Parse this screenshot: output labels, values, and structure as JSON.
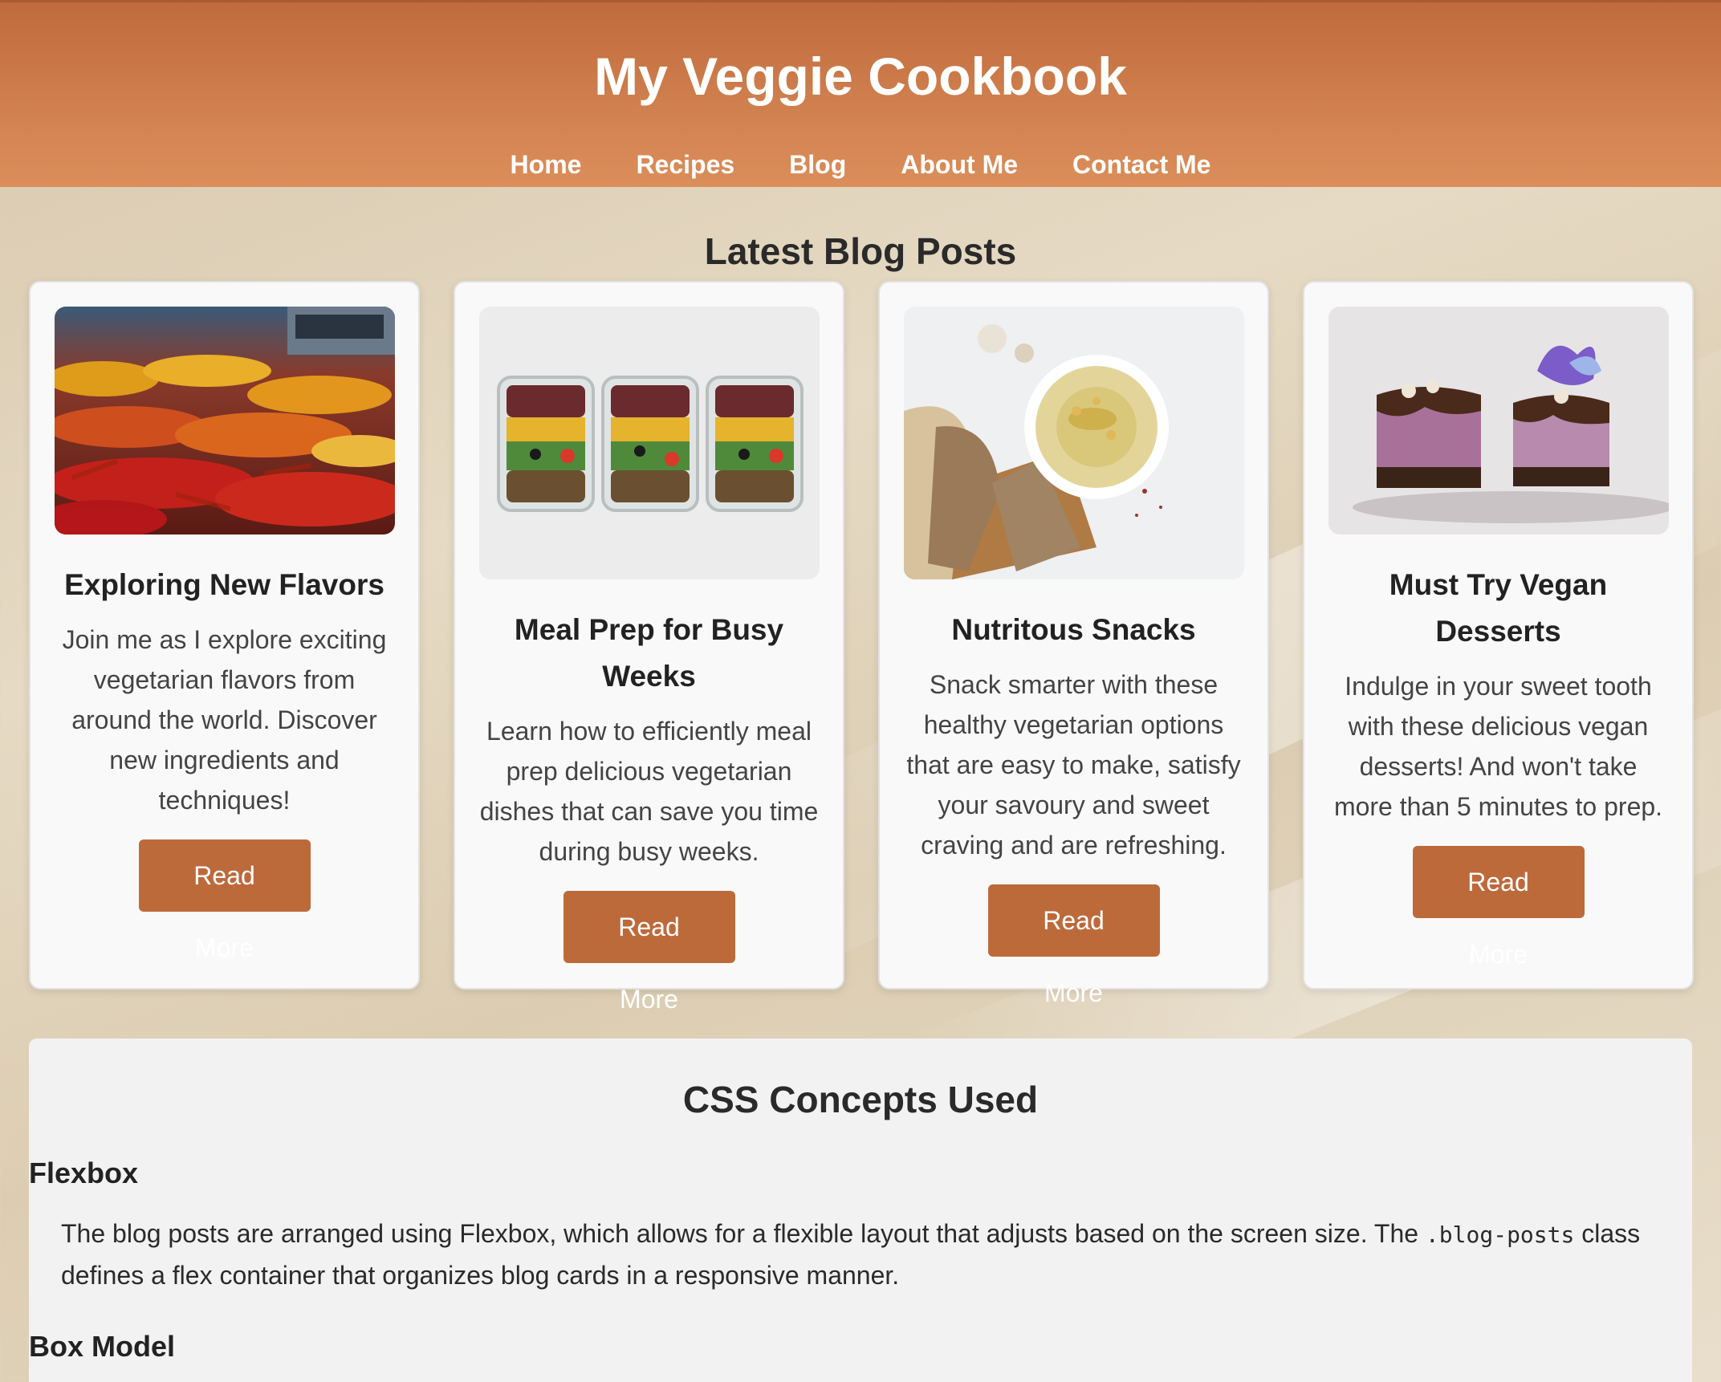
{
  "header": {
    "title": "My Veggie Cookbook",
    "nav": [
      "Home",
      "Recipes",
      "Blog",
      "About Me",
      "Contact Me"
    ]
  },
  "blog": {
    "heading": "Latest Blog Posts",
    "posts": [
      {
        "title": "Exploring New Flavors",
        "body": "Join me as I explore exciting vegetarian flavors from around the world. Discover new ingredients and techniques!",
        "button": "Read More",
        "image": "chili-peppers-market-photo"
      },
      {
        "title": "Meal Prep for Busy Weeks",
        "body": "Learn how to efficiently meal prep delicious vegetarian dishes that can save you time during busy weeks.",
        "button": "Read More",
        "image": "meal-prep-containers-photo"
      },
      {
        "title": "Nutritous Snacks",
        "body": "Snack smarter with these healthy vegetarian options that are easy to make, satisfy your savoury and sweet craving and are refreshing.",
        "button": "Read More",
        "image": "hummus-and-bread-photo"
      },
      {
        "title": "Must Try Vegan Desserts",
        "body": "Indulge in your sweet tooth with these delicious vegan desserts! And won't take more than 5 minutes to prep.",
        "button": "Read More",
        "image": "vegan-desserts-photo"
      }
    ]
  },
  "concepts": {
    "heading": "CSS Concepts Used",
    "flexbox_title": "Flexbox",
    "flexbox_text_1": "The blog posts are arranged using Flexbox, which allows for a flexible layout that adjusts based on the screen size. The ",
    "flexbox_code": ".blog-posts",
    "flexbox_text_2": " class defines a flex container that organizes blog cards in a responsive manner.",
    "boxmodel_title": "Box Model"
  },
  "colors": {
    "header": "#c97444",
    "button": "#bd6a3b",
    "card_bg": "#f9f9f9",
    "concepts_bg": "#f2f2f2"
  }
}
